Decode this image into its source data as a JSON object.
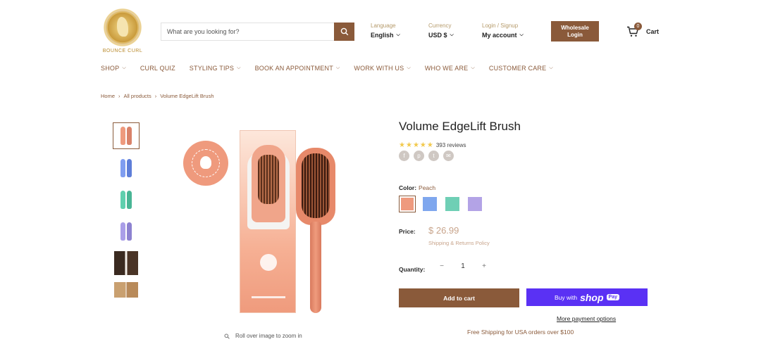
{
  "brand": {
    "logo_text": "BOUNCE CURL"
  },
  "search": {
    "placeholder": "What are you looking for?"
  },
  "header": {
    "language_label": "Language",
    "language_value": "English",
    "currency_label": "Currency",
    "currency_value": "USD $",
    "account_label": "Login / Signup",
    "account_value": "My account",
    "wholesale_line1": "Wholesale",
    "wholesale_line2": "Login",
    "cart_count": "0",
    "cart_label": "Cart"
  },
  "nav": {
    "items": [
      {
        "label": "SHOP",
        "dropdown": true
      },
      {
        "label": "CURL QUIZ",
        "dropdown": false
      },
      {
        "label": "STYLING TIPS",
        "dropdown": true
      },
      {
        "label": "BOOK AN APPOINTMENT",
        "dropdown": true
      },
      {
        "label": "WORK WITH US",
        "dropdown": true
      },
      {
        "label": "WHO WE ARE",
        "dropdown": true
      },
      {
        "label": "CUSTOMER CARE",
        "dropdown": true
      }
    ]
  },
  "breadcrumb": [
    "Home",
    "All products",
    "Volume EdgeLift Brush"
  ],
  "thumbnails": [
    {
      "color": "#ee9a7e"
    },
    {
      "color": "#7f9df0"
    },
    {
      "color": "#5fcfae"
    },
    {
      "color": "#a99ee8"
    },
    {
      "color": "#3a2a20"
    },
    {
      "color": "#c9a070"
    }
  ],
  "gallery": {
    "zoom_hint": "Roll over image to zoom in"
  },
  "product": {
    "title": "Volume EdgeLift Brush",
    "rating_stars": 5,
    "reviews": "393 reviews",
    "color_label": "Color:",
    "color_value": "Peach",
    "swatches": [
      "#ee9a7e",
      "#7fa7ee",
      "#6fcfb5",
      "#b3a3e6"
    ],
    "price_label": "Price:",
    "price": "$ 26.99",
    "shipping_link": "Shipping & Returns Policy",
    "quantity_label": "Quantity:",
    "quantity": "1",
    "add_to_cart": "Add to cart",
    "buy_with": "Buy with",
    "shop_text": "shop",
    "pay_text": "Pay",
    "more_payment": "More payment options",
    "free_shipping": "Free Shipping for USA orders over $100"
  },
  "colors": {
    "accent": "#8a5a3a",
    "shop_pay": "#5a31f4",
    "price": "#c8a48b"
  }
}
